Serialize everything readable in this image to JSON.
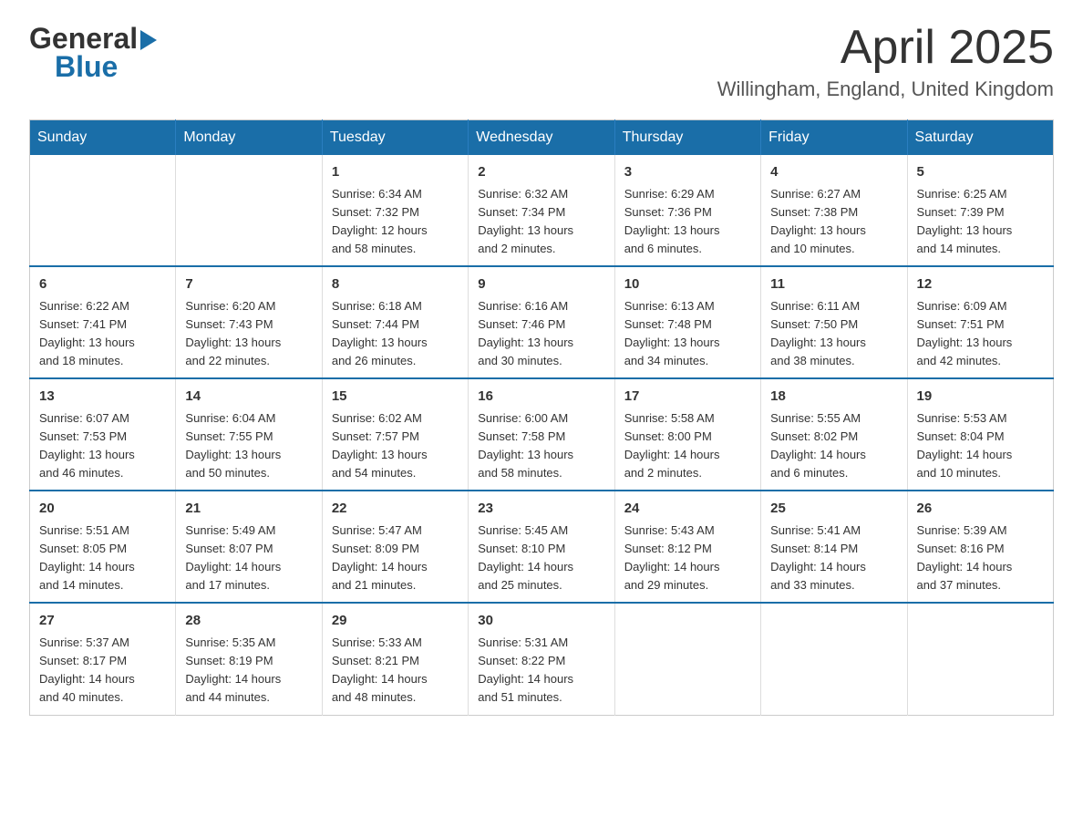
{
  "header": {
    "logo_general": "General",
    "logo_blue": "Blue",
    "month_title": "April 2025",
    "location": "Willingham, England, United Kingdom"
  },
  "days_of_week": [
    "Sunday",
    "Monday",
    "Tuesday",
    "Wednesday",
    "Thursday",
    "Friday",
    "Saturday"
  ],
  "weeks": [
    [
      {
        "day": "",
        "info": ""
      },
      {
        "day": "",
        "info": ""
      },
      {
        "day": "1",
        "info": "Sunrise: 6:34 AM\nSunset: 7:32 PM\nDaylight: 12 hours\nand 58 minutes."
      },
      {
        "day": "2",
        "info": "Sunrise: 6:32 AM\nSunset: 7:34 PM\nDaylight: 13 hours\nand 2 minutes."
      },
      {
        "day": "3",
        "info": "Sunrise: 6:29 AM\nSunset: 7:36 PM\nDaylight: 13 hours\nand 6 minutes."
      },
      {
        "day": "4",
        "info": "Sunrise: 6:27 AM\nSunset: 7:38 PM\nDaylight: 13 hours\nand 10 minutes."
      },
      {
        "day": "5",
        "info": "Sunrise: 6:25 AM\nSunset: 7:39 PM\nDaylight: 13 hours\nand 14 minutes."
      }
    ],
    [
      {
        "day": "6",
        "info": "Sunrise: 6:22 AM\nSunset: 7:41 PM\nDaylight: 13 hours\nand 18 minutes."
      },
      {
        "day": "7",
        "info": "Sunrise: 6:20 AM\nSunset: 7:43 PM\nDaylight: 13 hours\nand 22 minutes."
      },
      {
        "day": "8",
        "info": "Sunrise: 6:18 AM\nSunset: 7:44 PM\nDaylight: 13 hours\nand 26 minutes."
      },
      {
        "day": "9",
        "info": "Sunrise: 6:16 AM\nSunset: 7:46 PM\nDaylight: 13 hours\nand 30 minutes."
      },
      {
        "day": "10",
        "info": "Sunrise: 6:13 AM\nSunset: 7:48 PM\nDaylight: 13 hours\nand 34 minutes."
      },
      {
        "day": "11",
        "info": "Sunrise: 6:11 AM\nSunset: 7:50 PM\nDaylight: 13 hours\nand 38 minutes."
      },
      {
        "day": "12",
        "info": "Sunrise: 6:09 AM\nSunset: 7:51 PM\nDaylight: 13 hours\nand 42 minutes."
      }
    ],
    [
      {
        "day": "13",
        "info": "Sunrise: 6:07 AM\nSunset: 7:53 PM\nDaylight: 13 hours\nand 46 minutes."
      },
      {
        "day": "14",
        "info": "Sunrise: 6:04 AM\nSunset: 7:55 PM\nDaylight: 13 hours\nand 50 minutes."
      },
      {
        "day": "15",
        "info": "Sunrise: 6:02 AM\nSunset: 7:57 PM\nDaylight: 13 hours\nand 54 minutes."
      },
      {
        "day": "16",
        "info": "Sunrise: 6:00 AM\nSunset: 7:58 PM\nDaylight: 13 hours\nand 58 minutes."
      },
      {
        "day": "17",
        "info": "Sunrise: 5:58 AM\nSunset: 8:00 PM\nDaylight: 14 hours\nand 2 minutes."
      },
      {
        "day": "18",
        "info": "Sunrise: 5:55 AM\nSunset: 8:02 PM\nDaylight: 14 hours\nand 6 minutes."
      },
      {
        "day": "19",
        "info": "Sunrise: 5:53 AM\nSunset: 8:04 PM\nDaylight: 14 hours\nand 10 minutes."
      }
    ],
    [
      {
        "day": "20",
        "info": "Sunrise: 5:51 AM\nSunset: 8:05 PM\nDaylight: 14 hours\nand 14 minutes."
      },
      {
        "day": "21",
        "info": "Sunrise: 5:49 AM\nSunset: 8:07 PM\nDaylight: 14 hours\nand 17 minutes."
      },
      {
        "day": "22",
        "info": "Sunrise: 5:47 AM\nSunset: 8:09 PM\nDaylight: 14 hours\nand 21 minutes."
      },
      {
        "day": "23",
        "info": "Sunrise: 5:45 AM\nSunset: 8:10 PM\nDaylight: 14 hours\nand 25 minutes."
      },
      {
        "day": "24",
        "info": "Sunrise: 5:43 AM\nSunset: 8:12 PM\nDaylight: 14 hours\nand 29 minutes."
      },
      {
        "day": "25",
        "info": "Sunrise: 5:41 AM\nSunset: 8:14 PM\nDaylight: 14 hours\nand 33 minutes."
      },
      {
        "day": "26",
        "info": "Sunrise: 5:39 AM\nSunset: 8:16 PM\nDaylight: 14 hours\nand 37 minutes."
      }
    ],
    [
      {
        "day": "27",
        "info": "Sunrise: 5:37 AM\nSunset: 8:17 PM\nDaylight: 14 hours\nand 40 minutes."
      },
      {
        "day": "28",
        "info": "Sunrise: 5:35 AM\nSunset: 8:19 PM\nDaylight: 14 hours\nand 44 minutes."
      },
      {
        "day": "29",
        "info": "Sunrise: 5:33 AM\nSunset: 8:21 PM\nDaylight: 14 hours\nand 48 minutes."
      },
      {
        "day": "30",
        "info": "Sunrise: 5:31 AM\nSunset: 8:22 PM\nDaylight: 14 hours\nand 51 minutes."
      },
      {
        "day": "",
        "info": ""
      },
      {
        "day": "",
        "info": ""
      },
      {
        "day": "",
        "info": ""
      }
    ]
  ]
}
